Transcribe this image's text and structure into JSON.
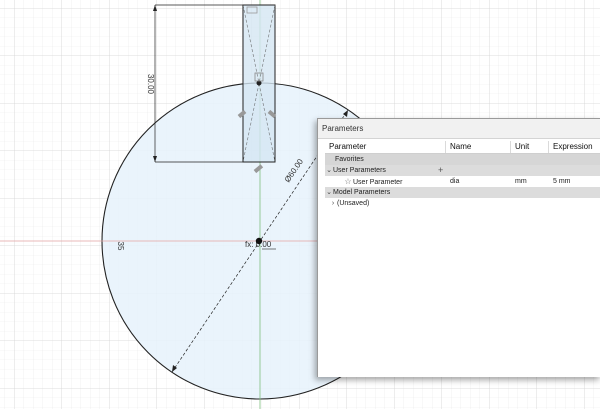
{
  "sketch": {
    "dim_height": "30.00",
    "dim_diameter": "Ø60.00",
    "dim_left": "35",
    "dim_fx": "fx: 0.00"
  },
  "parameters_dialog": {
    "title": "Parameters",
    "columns": [
      "Parameter",
      "Name",
      "Unit",
      "Expression"
    ],
    "favorites_label": "Favorites",
    "user_parameters_label": "User Parameters",
    "add_icon": "plus-icon",
    "user_parameter_row": {
      "icon": "star-icon",
      "label": "User Parameter",
      "name": "dia",
      "unit": "mm",
      "expression": "5 mm"
    },
    "model_parameters_label": "Model Parameters",
    "model_parameter_row": {
      "label": "(Unsaved)"
    }
  }
}
